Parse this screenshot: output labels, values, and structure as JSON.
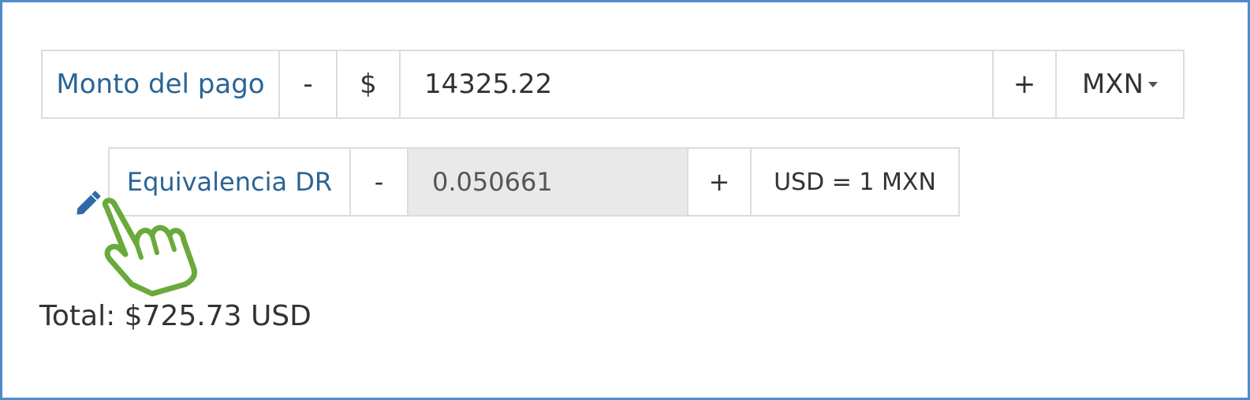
{
  "payment": {
    "label": "Monto del pago",
    "minus": "-",
    "currency_symbol": "$",
    "amount_value": "14325.22",
    "plus": "+",
    "currency": "MXN"
  },
  "equivalence": {
    "label": "Equivalencia DR",
    "minus": "-",
    "rate_value": "0.050661",
    "plus": "+",
    "unit": "USD = 1 MXN"
  },
  "total": {
    "text": "Total: $725.73 USD"
  },
  "icons": {
    "edit": "pencil-icon",
    "pointer": "hand-pointer-icon"
  },
  "colors": {
    "frame_border": "#4f8ccc",
    "label_text": "#2a6496",
    "hand_outline": "#6aaa3c",
    "readonly_bg": "#e9e9e9"
  }
}
